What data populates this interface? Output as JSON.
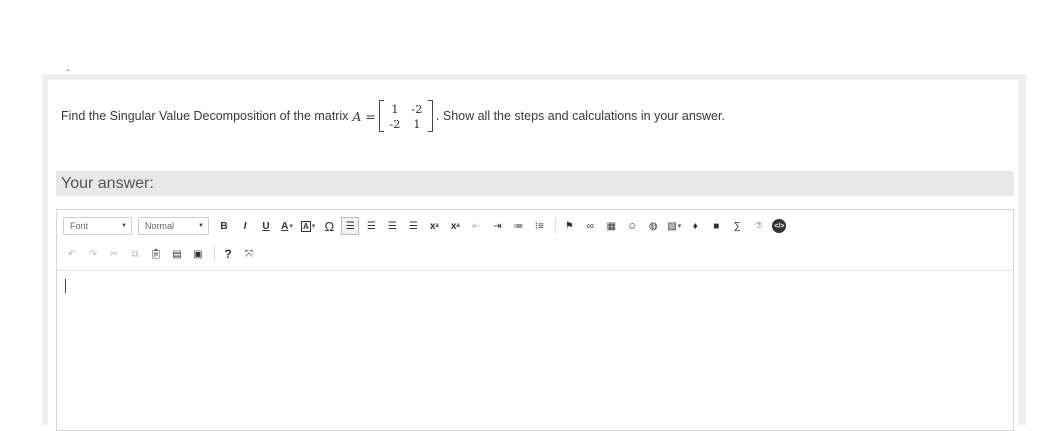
{
  "question": {
    "text_before": "Find the Singular Value Decomposition of the matrix",
    "matrix_label": "A =",
    "matrix": [
      [
        "1",
        "-2"
      ],
      [
        "-2",
        "1"
      ]
    ],
    "text_after": ". Show all the steps and calculations in your answer."
  },
  "answer_section": {
    "label": "Your answer:"
  },
  "editor": {
    "font_combo": "Font",
    "size_combo": "Normal",
    "toolbar_row1": [
      {
        "name": "bold-button",
        "label": "B"
      },
      {
        "name": "italic-button",
        "label": "I"
      },
      {
        "name": "underline-button",
        "label": "U"
      },
      {
        "name": "text-color-button",
        "label": "A"
      },
      {
        "name": "bg-color-button",
        "label": "A"
      },
      {
        "name": "special-char-button",
        "label": "Ω"
      }
    ],
    "help_label": "?",
    "subscript_label": "x",
    "superscript_label": "x",
    "source_label": "</>"
  }
}
